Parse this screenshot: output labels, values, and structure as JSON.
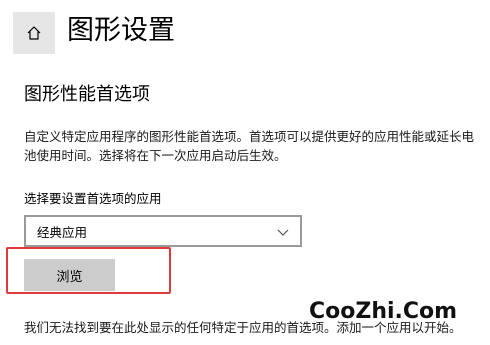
{
  "header": {
    "home_icon": "home-icon",
    "title": "图形设置"
  },
  "graphics_performance": {
    "section_title": "图形性能首选项",
    "description": "自定义特定应用程序的图形性能首选项。首选项可以提供更好的应用性能或延长电池使用时间。选择将在下一次应用启动后生效。",
    "select_label": "选择要设置首选项的应用",
    "app_type_selected": "经典应用",
    "dropdown_icon": "chevron-down-icon",
    "browse_label": "浏览",
    "info_text": "我们无法找到要在此处显示的任何特定于应用的首选项。添加一个应用以开始。"
  },
  "annotation": {
    "highlight_color": "#e03a3a"
  },
  "watermark": {
    "text": "CooZhi.Com"
  }
}
